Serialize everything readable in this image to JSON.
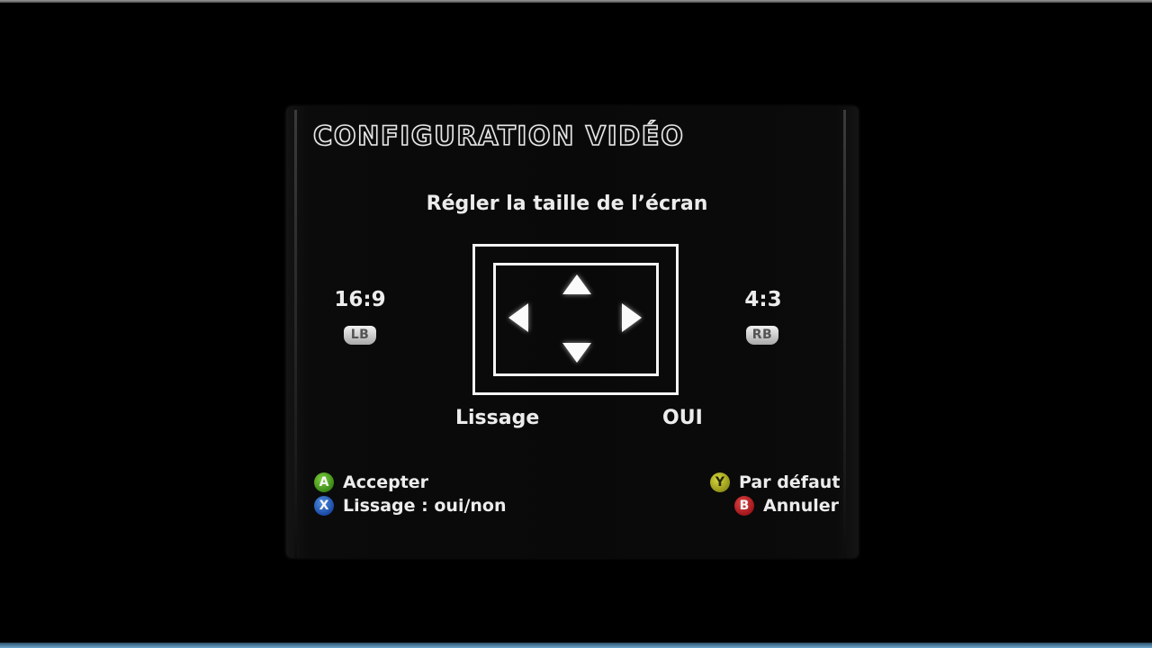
{
  "header": {
    "title": "CONFIGURATION VIDÉO"
  },
  "main": {
    "subtitle": "Régler la taille de l’écran",
    "ratio_left": {
      "label": "16:9",
      "button": "LB"
    },
    "ratio_right": {
      "label": "4:3",
      "button": "RB"
    },
    "option": {
      "name": "Lissage",
      "value": "OUI"
    }
  },
  "hints": {
    "accept": {
      "button": "A",
      "label": "Accepter"
    },
    "smoothing": {
      "button": "X",
      "label": "Lissage : oui/non"
    },
    "default": {
      "button": "Y",
      "label": "Par défaut"
    },
    "cancel": {
      "button": "B",
      "label": "Annuler"
    }
  },
  "colors": {
    "a_button": "#3b8a16",
    "x_button": "#1b4aa6",
    "y_button": "#939418",
    "b_button": "#a1161b"
  },
  "icons": {
    "up": "arrow-up-icon",
    "down": "arrow-down-icon",
    "left": "arrow-left-icon",
    "right": "arrow-right-icon"
  }
}
